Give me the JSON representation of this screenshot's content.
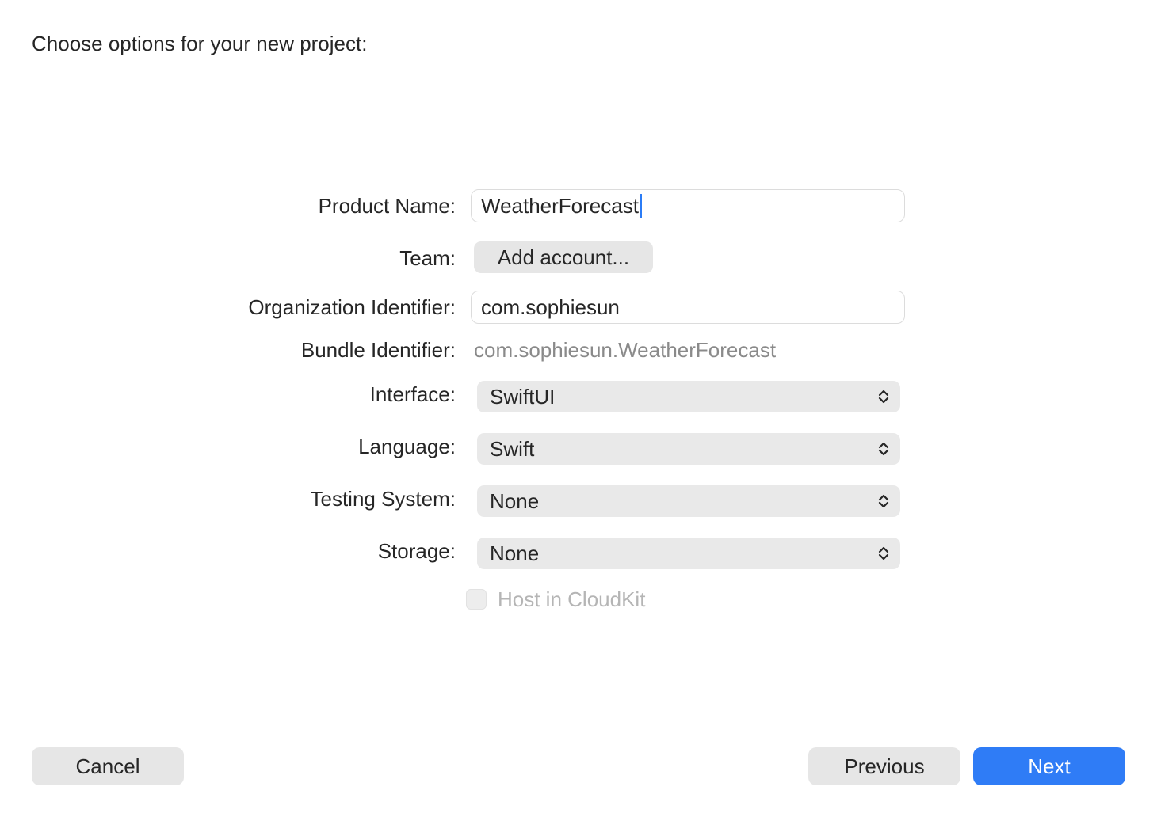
{
  "heading": "Choose options for your new project:",
  "form": {
    "product_name": {
      "label": "Product Name:",
      "value": "WeatherForecast"
    },
    "team": {
      "label": "Team:",
      "button_label": "Add account..."
    },
    "organization_identifier": {
      "label": "Organization Identifier:",
      "value": "com.sophiesun"
    },
    "bundle_identifier": {
      "label": "Bundle Identifier:",
      "value": "com.sophiesun.WeatherForecast"
    },
    "interface": {
      "label": "Interface:",
      "selected": "SwiftUI"
    },
    "language": {
      "label": "Language:",
      "selected": "Swift"
    },
    "testing_system": {
      "label": "Testing System:",
      "selected": "None"
    },
    "storage": {
      "label": "Storage:",
      "selected": "None"
    },
    "host_in_cloudkit": {
      "label": "Host in CloudKit",
      "checked": false,
      "enabled": false
    }
  },
  "footer": {
    "cancel_label": "Cancel",
    "previous_label": "Previous",
    "next_label": "Next"
  },
  "icons": {
    "popup_arrows": "chevron-up-down-icon"
  },
  "colors": {
    "accent": "#2f7cf6",
    "caret": "#2b7cf6",
    "secondary_text": "#8a8a8a",
    "disabled_text": "#b5b5b5"
  }
}
